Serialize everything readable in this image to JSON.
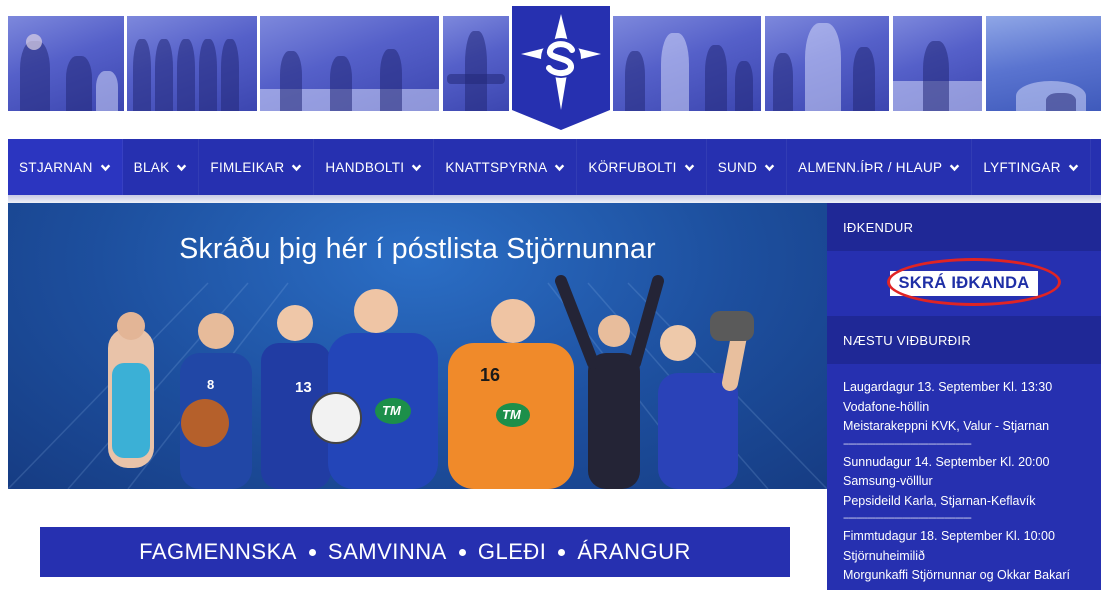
{
  "nav": {
    "items": [
      {
        "label": "STJARNAN"
      },
      {
        "label": "BLAK"
      },
      {
        "label": "FIMLEIKAR"
      },
      {
        "label": "HANDBOLTI"
      },
      {
        "label": "KNATTSPYRNA"
      },
      {
        "label": "KÖRFUBOLTI"
      },
      {
        "label": "SUND"
      },
      {
        "label": "ALMENN.ÍÞR / HLAUP"
      },
      {
        "label": "LYFTINGAR"
      }
    ]
  },
  "banner": {
    "title": "Skráðu þig hér í póstlista Stjörnunnar",
    "jersey_numbers": [
      "8",
      "13",
      "16"
    ],
    "sponsor": "TM"
  },
  "slogan": {
    "words": [
      "FAGMENNSKA",
      "SAMVINNA",
      "GLEÐI",
      "ÁRANGUR"
    ]
  },
  "sidebar": {
    "section1_title": "IÐKENDUR",
    "register_label": "SKRÁ IÐKANDA",
    "section2_title": "NÆSTU VIÐBURÐIR",
    "events": [
      {
        "when": "Laugardagur 13. September Kl. 13:30",
        "where": "Vodafone-höllin",
        "what": "Meistarakeppni KVK, Valur - Stjarnan"
      },
      {
        "when": "Sunnudagur 14. September Kl. 20:00",
        "where": "Samsung-völllur",
        "what": "Pepsideild Karla, Stjarnan-Keflavík"
      },
      {
        "when": "Fimmtudagur 18. September Kl. 10:00",
        "where": "Stjörnuheimilið",
        "what": "Morgunkaffi Stjörnunnar og Okkar Bakarí"
      }
    ],
    "separator": "------------------------------------------------"
  },
  "colors": {
    "nav_blue": "#2630b0",
    "sidebar_head": "#1f2896",
    "highlight_ring": "#e02424",
    "banner_blue": "#1d4f9e"
  }
}
